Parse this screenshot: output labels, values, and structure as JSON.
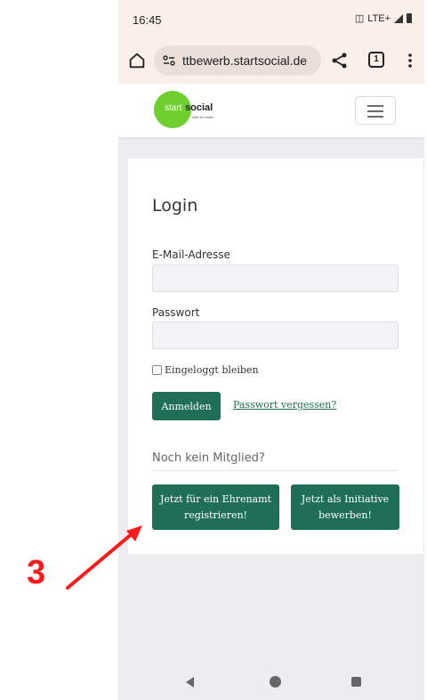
{
  "status_bar": {
    "time": "16:45",
    "network": "LTE+"
  },
  "browser": {
    "url": "ttbewerb.startsocial.de",
    "tab_count": "1"
  },
  "site_header": {
    "logo": {
      "start": "start",
      "social": "social",
      "tagline": "hilfe für helfer"
    }
  },
  "login": {
    "title": "Login",
    "email_label": "E-Mail-Adresse",
    "email_value": "",
    "password_label": "Passwort",
    "password_value": "",
    "remember_label": "Eingeloggt bleiben",
    "login_button": "Anmelden",
    "forgot_link": "Passwort vergessen?",
    "no_member_heading": "Noch kein Mitglied?",
    "register_volunteer_line1": "Jetzt für ein Ehrenamt",
    "register_volunteer_line2": "registrieren!",
    "register_initiative_line1": "Jetzt als Initiative",
    "register_initiative_line2": "bewerben!"
  },
  "annotation": {
    "number": "3",
    "color": "#ff1a1a"
  },
  "colors": {
    "primary": "#1f6e57",
    "logo_green": "#6fcf2e",
    "browser_bar": "#fbefea",
    "page_background": "#ececf1"
  },
  "icons": {
    "home": "home-icon",
    "site_settings": "site-settings-icon",
    "share": "share-icon",
    "tabs": "tabs-icon",
    "more": "more-vertical-icon",
    "menu": "hamburger-menu-icon",
    "nav_back": "back-triangle-icon",
    "nav_home": "home-circle-icon",
    "nav_recents": "recents-square-icon"
  }
}
